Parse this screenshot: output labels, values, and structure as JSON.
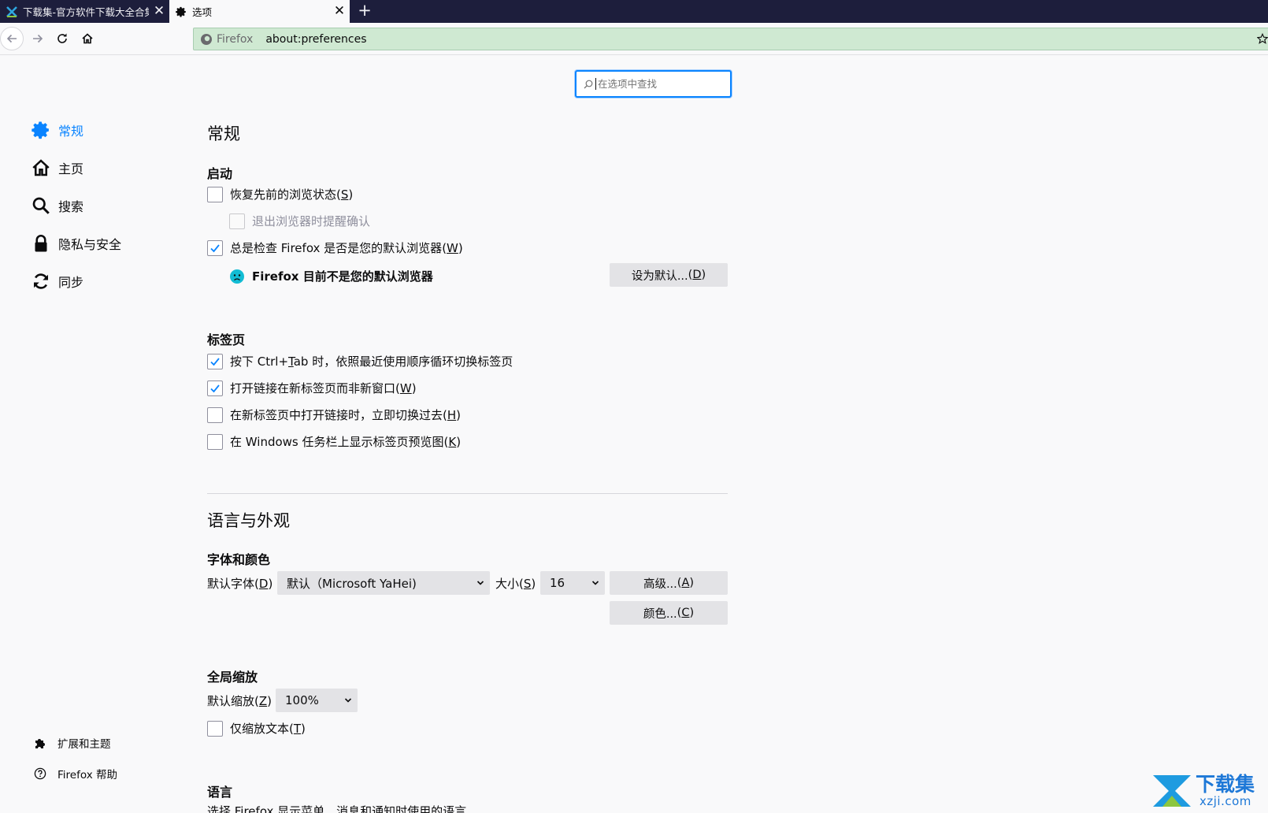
{
  "tabs": [
    {
      "title": "下载集-官方软件下载大全合集",
      "close": "✕"
    },
    {
      "title": "选项",
      "close": "✕"
    }
  ],
  "new_tab": "+",
  "nav": {
    "identity_label": "Firefox",
    "url": "about:preferences"
  },
  "search": {
    "placeholder": "在选项中查找"
  },
  "sidebar": {
    "items": [
      {
        "label": "常规",
        "icon": "gear-icon",
        "active": true
      },
      {
        "label": "主页",
        "icon": "home-icon"
      },
      {
        "label": "搜索",
        "icon": "search-icon"
      },
      {
        "label": "隐私与安全",
        "icon": "lock-icon"
      },
      {
        "label": "同步",
        "icon": "sync-icon"
      }
    ],
    "footer": [
      {
        "label": "扩展和主题",
        "icon": "puzzle-icon"
      },
      {
        "label": "Firefox 帮助",
        "icon": "help-icon"
      }
    ]
  },
  "general": {
    "title": "常规",
    "startup": {
      "heading": "启动",
      "restore_session": {
        "text": "恢复先前的浏览状态",
        "key": "S",
        "checked": false
      },
      "warn_on_quit": {
        "text": "退出浏览器时提醒确认",
        "checked": false,
        "disabled": true
      },
      "check_default": {
        "text": "总是检查 Firefox 是否是您的默认浏览器",
        "key": "W",
        "checked": true
      },
      "default_status": "Firefox 目前不是您的默认浏览器",
      "set_default_button": {
        "text": "设为默认...",
        "key": "D"
      }
    },
    "tabs_section": {
      "heading": "标签页",
      "ctrl_tab": {
        "pre": "按下 Ctrl+",
        "key": "T",
        "post": "ab 时，依照最近使用顺序循环切换标签页",
        "checked": true
      },
      "open_links_new_tab": {
        "text": "打开链接在新标签页而非新窗口",
        "key": "W",
        "checked": true
      },
      "switch_to_new_tab": {
        "text": "在新标签页中打开链接时，立即切换过去",
        "key": "H",
        "checked": false
      },
      "taskbar_previews": {
        "text": "在 Windows 任务栏上显示标签页预览图",
        "key": "K",
        "checked": false
      }
    }
  },
  "language_appearance": {
    "title": "语言与外观",
    "fonts": {
      "heading": "字体和颜色",
      "default_font_label": "默认字体",
      "default_font_key": "D",
      "default_font_value": "默认（Microsoft YaHei)",
      "size_label": "大小",
      "size_key": "S",
      "size_value": "16",
      "advanced_button": {
        "text": "高级...",
        "key": "A"
      },
      "colors_button": {
        "text": "颜色...",
        "key": "C"
      }
    },
    "zoom": {
      "heading": "全局缩放",
      "default_zoom_label": "默认缩放",
      "default_zoom_key": "Z",
      "default_zoom_value": "100%",
      "zoom_text_only": {
        "text": "仅缩放文本",
        "key": "T",
        "checked": false
      }
    },
    "language": {
      "heading": "语言",
      "description": "选择 Firefox 显示菜单、消息和通知时使用的语言"
    }
  },
  "watermark": {
    "title": "下载集",
    "url": "xzji.com"
  },
  "colors": {
    "accent": "#0a84ff",
    "tabstrip": "#1d1e3c",
    "urlbar": "#cfe9d2",
    "button": "#e3e3e6",
    "page": "#f9f9fa"
  }
}
